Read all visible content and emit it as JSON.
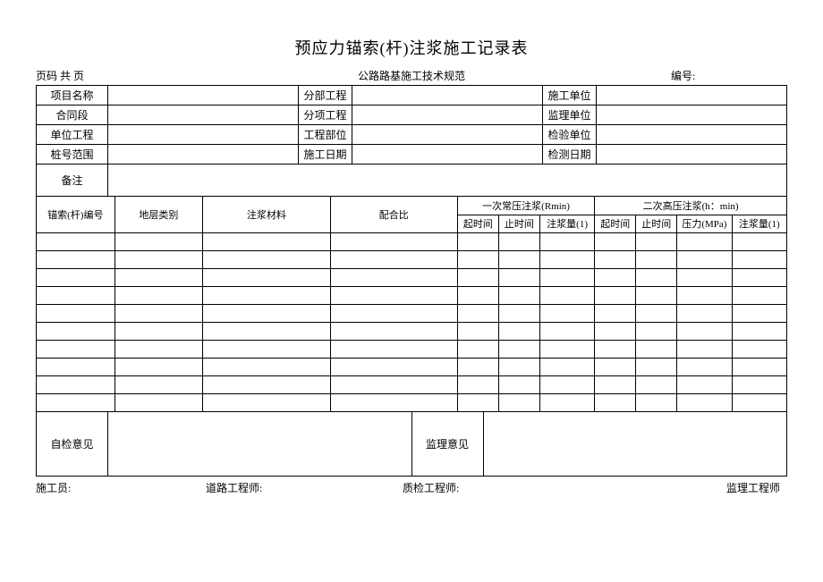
{
  "title": "预应力锚索(杆)注浆施工记录表",
  "meta": {
    "page_label": "页码  共   页",
    "spec_label": "公路路基施工技术规范",
    "code_label": "编号:"
  },
  "info": {
    "r1c1": "项目名称",
    "r1c3": "分部工程",
    "r1c5": "施工单位",
    "r2c1": "合同段",
    "r2c3": "分项工程",
    "r2c5": "监理单位",
    "r3c1": "单位工程",
    "r3c3": "工程部位",
    "r3c5": "检验单位",
    "r4c1": "桩号范围",
    "r4c3": "施工日期",
    "r4c5": "检测日期",
    "r5c1": "备注"
  },
  "headers": {
    "h1": "锚索(杆)编号",
    "h2": "地层类别",
    "h3": "注浆材料",
    "h4": "配合比",
    "h5": "一次常压注浆(Rmin)",
    "h6": "二次高压注浆(h：min)",
    "s1": "起时间",
    "s2": "止时间",
    "s3": "注浆量(1)",
    "s4": "起时间",
    "s5": "止时间",
    "s6": "压力(MPa)",
    "s7": "注浆量(1)"
  },
  "opinions": {
    "self": "自检意见",
    "supervise": "监理意见"
  },
  "footer": {
    "f1": "施工员:",
    "f2": "道路工程师:",
    "f3": "质检工程师:",
    "f4": "监理工程师"
  }
}
